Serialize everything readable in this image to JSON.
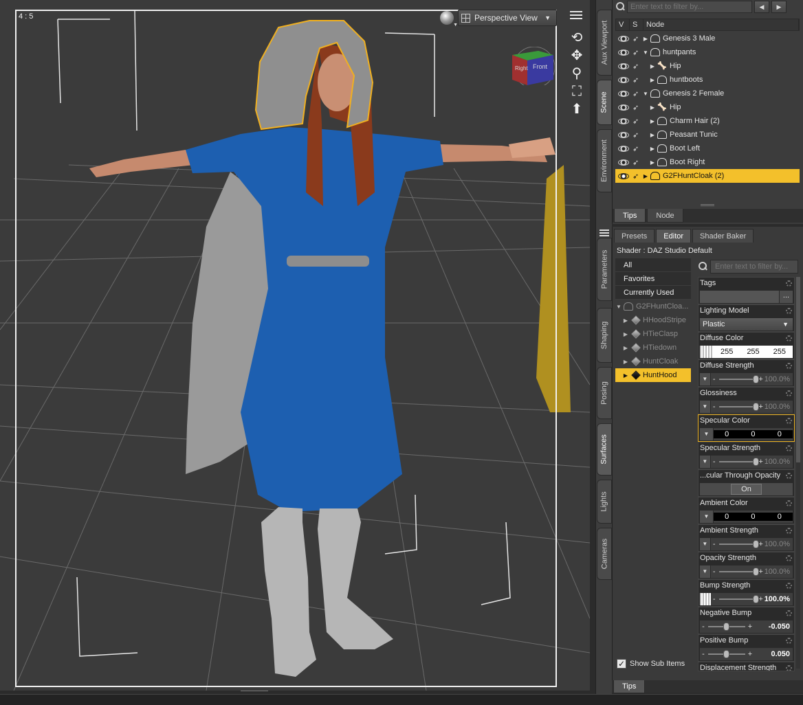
{
  "viewport": {
    "aspect_label": "4 : 5",
    "view_name": "Perspective View",
    "cube": {
      "left_face": "Right",
      "front_face": "Front"
    }
  },
  "side_tabs": [
    "Aux Viewport",
    "Scene",
    "Environment",
    "Parameters",
    "Shaping",
    "Posing",
    "Surfaces",
    "Lights",
    "Cameras"
  ],
  "scene": {
    "filter_placeholder": "Enter text to filter by...",
    "columns": {
      "v": "V",
      "s": "S",
      "node": "Node"
    },
    "nodes": [
      {
        "label": "Genesis 3 Male",
        "icon": "figure-icon",
        "expanded": false,
        "indent": 0
      },
      {
        "label": "huntpants",
        "icon": "figure-icon",
        "expanded": true,
        "indent": 0
      },
      {
        "label": "Hip",
        "icon": "bone-icon",
        "expanded": false,
        "indent": 1
      },
      {
        "label": "huntboots",
        "icon": "figure-icon",
        "expanded": false,
        "indent": 1
      },
      {
        "label": "Genesis 2 Female",
        "icon": "figure-icon",
        "expanded": true,
        "indent": 0
      },
      {
        "label": "Hip",
        "icon": "bone-icon",
        "expanded": false,
        "indent": 1
      },
      {
        "label": "Charm Hair (2)",
        "icon": "figure-icon",
        "expanded": false,
        "indent": 1
      },
      {
        "label": "Peasant Tunic",
        "icon": "figure-icon",
        "expanded": false,
        "indent": 1
      },
      {
        "label": "Boot Left",
        "icon": "figure-icon",
        "expanded": false,
        "indent": 1
      },
      {
        "label": "Boot Right",
        "icon": "figure-icon",
        "expanded": false,
        "indent": 1
      },
      {
        "label": "G2FHuntCloak (2)",
        "icon": "figure-icon",
        "expanded": false,
        "indent": 0,
        "selected": true
      }
    ],
    "tabs": [
      "Tips",
      "Node"
    ]
  },
  "surfaces": {
    "tabs": [
      "Presets",
      "Editor",
      "Shader Baker"
    ],
    "shader_label": "Shader : DAZ Studio Default",
    "categories": [
      "All",
      "Favorites",
      "Currently Used"
    ],
    "root": "G2FHuntCloa...",
    "materials": [
      "HHoodStripe",
      "HTieClasp",
      "HTiedown",
      "HuntCloak",
      "HuntHood"
    ],
    "selected_material": "HuntHood",
    "show_sub_items": "Show Sub Items",
    "filter_placeholder": "Enter text to filter by...",
    "properties": {
      "tags": {
        "name": "Tags",
        "button": "..."
      },
      "lighting_model": {
        "name": "Lighting Model",
        "value": "Plastic"
      },
      "diffuse_color": {
        "name": "Diffuse Color",
        "r": "255",
        "g": "255",
        "b": "255"
      },
      "diffuse_strength": {
        "name": "Diffuse Strength",
        "value": "100.0%",
        "fraction": 1.0
      },
      "glossiness": {
        "name": "Glossiness",
        "value": "100.0%",
        "fraction": 1.0
      },
      "specular_color": {
        "name": "Specular Color",
        "r": "0",
        "g": "0",
        "b": "0"
      },
      "specular_strength": {
        "name": "Specular Strength",
        "value": "100.0%",
        "fraction": 1.0
      },
      "spec_through_opacity": {
        "name": "...cular Through Opacity",
        "value": "On"
      },
      "ambient_color": {
        "name": "Ambient Color",
        "r": "0",
        "g": "0",
        "b": "0"
      },
      "ambient_strength": {
        "name": "Ambient Strength",
        "value": "100.0%",
        "fraction": 1.0
      },
      "opacity_strength": {
        "name": "Opacity Strength",
        "value": "100.0%",
        "fraction": 1.0
      },
      "bump_strength": {
        "name": "Bump Strength",
        "value": "100.0%",
        "fraction": 1.0
      },
      "negative_bump": {
        "name": "Negative Bump",
        "value": "-0.050",
        "fraction": 0.5
      },
      "positive_bump": {
        "name": "Positive Bump",
        "value": "0.050",
        "fraction": 0.5
      },
      "displacement_strength": {
        "name": "Displacement Strength"
      }
    }
  },
  "bottom_tabs": [
    "Tips"
  ],
  "colors": {
    "selection": "#f3c02b",
    "highlight_border": "#e9b020"
  }
}
